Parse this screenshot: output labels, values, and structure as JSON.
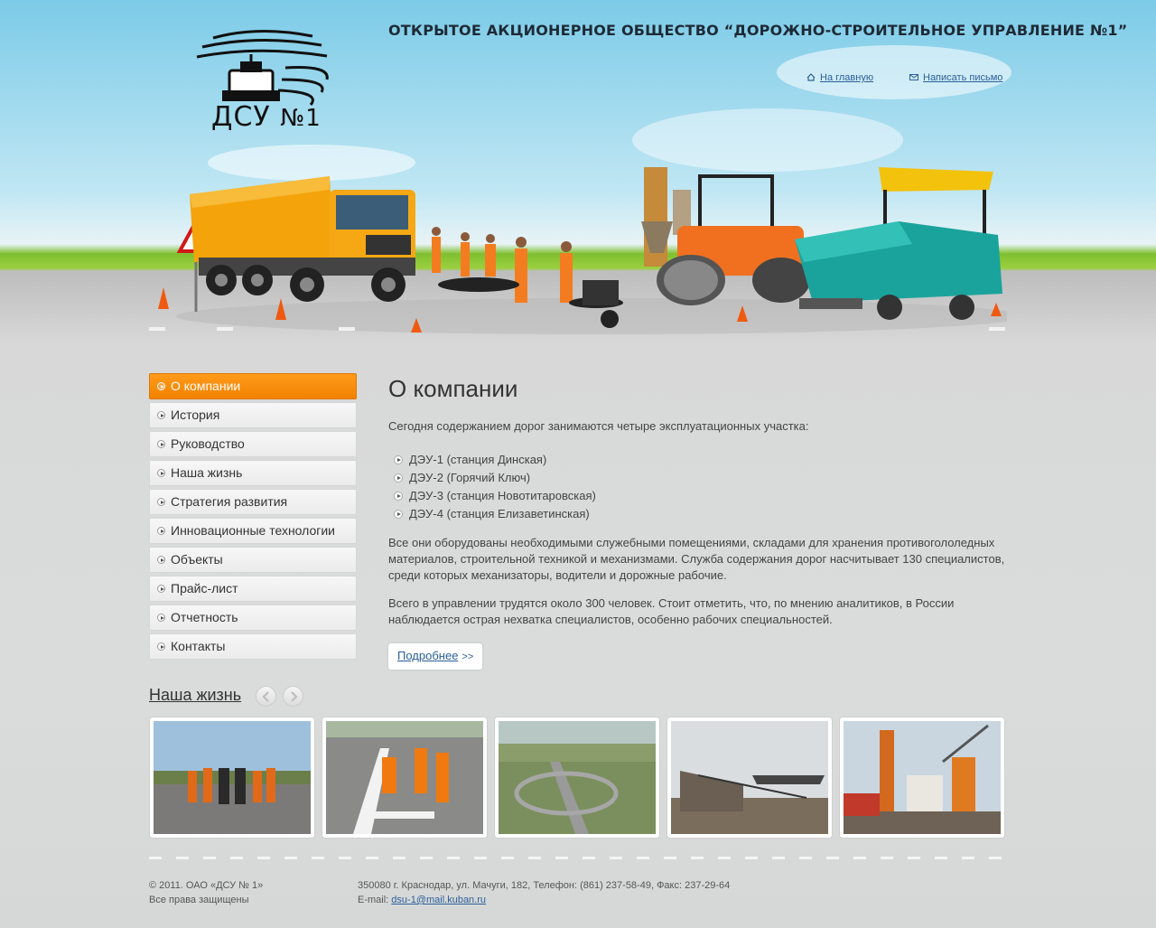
{
  "header": {
    "title": "ОТКРЫТОЕ АКЦИОНЕРНОЕ ОБЩЕСТВО “ДОРОЖНО-СТРОИТЕЛЬНОЕ УПРАВЛЕНИЕ №1”",
    "logo_text": "ДСУ",
    "logo_number": "№1",
    "home_link": "На главную",
    "mail_link": "Написать письмо",
    "sign_icon": "road-works-sign-icon"
  },
  "sidebar": {
    "items": [
      {
        "label": "О компании",
        "active": true
      },
      {
        "label": "История"
      },
      {
        "label": "Руководство"
      },
      {
        "label": "Наша жизнь"
      },
      {
        "label": "Стратегия развития"
      },
      {
        "label": "Инновационные технологии"
      },
      {
        "label": "Объекты"
      },
      {
        "label": "Прайс-лист"
      },
      {
        "label": "Отчетность"
      },
      {
        "label": "Контакты"
      }
    ]
  },
  "main": {
    "heading": "О компании",
    "intro": "Сегодня содержанием дорог занимаются четыре эксплуатационных участка:",
    "list": [
      "ДЭУ-1 (станция Динская)",
      "ДЭУ-2 (Горячий Ключ)",
      "ДЭУ-3 (станция Новотитаровская)",
      "ДЭУ-4 (станция Елизаветинская)"
    ],
    "para1": "Все они оборудованы необходимыми служебными помещениями, складами для хранения противогололедных материалов, строительной техникой и механизмами. Служба содержания дорог насчитывает 130 специалистов, среди которых механизаторы, водители и дорожные рабочие.",
    "para2": "Всего в управлении трудятся около 300 человек. Стоит отметить, что, по мнению аналитиков, в России наблюдается острая нехватка специалистов, особенно рабочих специальностей.",
    "more": "Подробнее",
    "more_arrow": ">>"
  },
  "gallery": {
    "title": "Наша жизнь",
    "photos": [
      "workers-group-photo",
      "road-marking-photo",
      "highway-interchange-photo",
      "crushing-plant-photo",
      "asphalt-plant-photo"
    ]
  },
  "footer": {
    "copyright": "© 2011. ОАО «ДСУ № 1»",
    "rights": "Все права защищены",
    "address": "350080 г. Краснодар, ул. Мачуги, 182, Телефон: (861) 237-58-49, Факс: 237-29-64",
    "email_label": "E-mail:",
    "email": "dsu-1@mail.kuban.ru"
  },
  "colors": {
    "accent": "#f28200",
    "link": "#2a5f99",
    "grass": "#8cc63f"
  }
}
